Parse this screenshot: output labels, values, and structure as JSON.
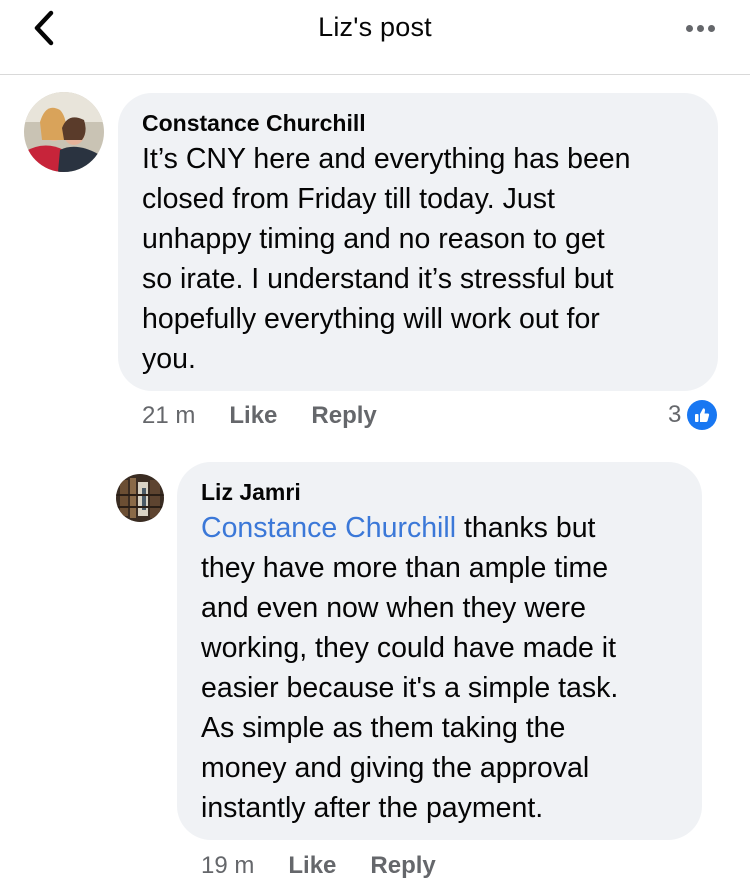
{
  "header": {
    "title": "Liz's post"
  },
  "comments": [
    {
      "author": "Constance Churchill",
      "lines": [
        "It’s CNY here and everything has been",
        "closed from Friday till today. Just",
        "unhappy timing and no reason to get",
        "so irate. I understand it’s stressful but",
        "hopefully everything will work out for",
        "you."
      ],
      "time": "21 m",
      "like_label": "Like",
      "reply_label": "Reply",
      "reaction_count": "3"
    },
    {
      "author": "Liz Jamri",
      "mention": "Constance Churchill",
      "first_line_rest": " thanks but",
      "lines": [
        "they have more than ample time",
        "and even now when they were",
        "working, they could have made it",
        "easier because it's a simple task.",
        "As simple as them taking the",
        "money and giving the approval",
        "instantly after the payment."
      ],
      "time": "19 m",
      "like_label": "Like",
      "reply_label": "Reply"
    }
  ],
  "colors": {
    "bubble": "#f0f2f5",
    "mention": "#3b78d8",
    "like_badge": "#1877f2",
    "meta_text": "#65676b"
  },
  "icons": {
    "back": "chevron-left-icon",
    "more": "more-horizontal-icon",
    "like_reaction": "thumbs-up-icon"
  }
}
